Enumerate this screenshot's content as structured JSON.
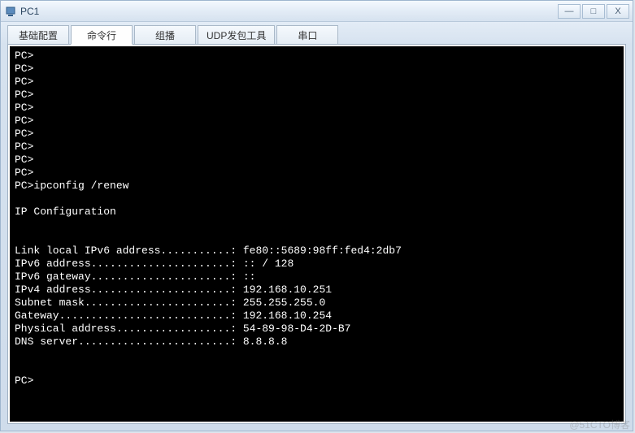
{
  "window": {
    "title": "PC1"
  },
  "controls": {
    "minimize": "—",
    "maximize": "□",
    "close": "X"
  },
  "tabs": [
    {
      "label": "基础配置",
      "active": false
    },
    {
      "label": "命令行",
      "active": true
    },
    {
      "label": "组播",
      "active": false
    },
    {
      "label": "UDP发包工具",
      "active": false
    },
    {
      "label": "串口",
      "active": false
    }
  ],
  "terminal_lines": [
    "PC>",
    "PC>",
    "PC>",
    "PC>",
    "PC>",
    "PC>",
    "PC>",
    "PC>",
    "PC>",
    "PC>",
    "PC>ipconfig /renew",
    "",
    "IP Configuration",
    "",
    "",
    "Link local IPv6 address...........: fe80::5689:98ff:fed4:2db7",
    "IPv6 address......................: :: / 128",
    "IPv6 gateway......................: ::",
    "IPv4 address......................: 192.168.10.251",
    "Subnet mask.......................: 255.255.255.0",
    "Gateway...........................: 192.168.10.254",
    "Physical address..................: 54-89-98-D4-2D-B7",
    "DNS server........................: 8.8.8.8",
    "",
    "",
    "PC>"
  ],
  "watermark": "@51CTO博客"
}
